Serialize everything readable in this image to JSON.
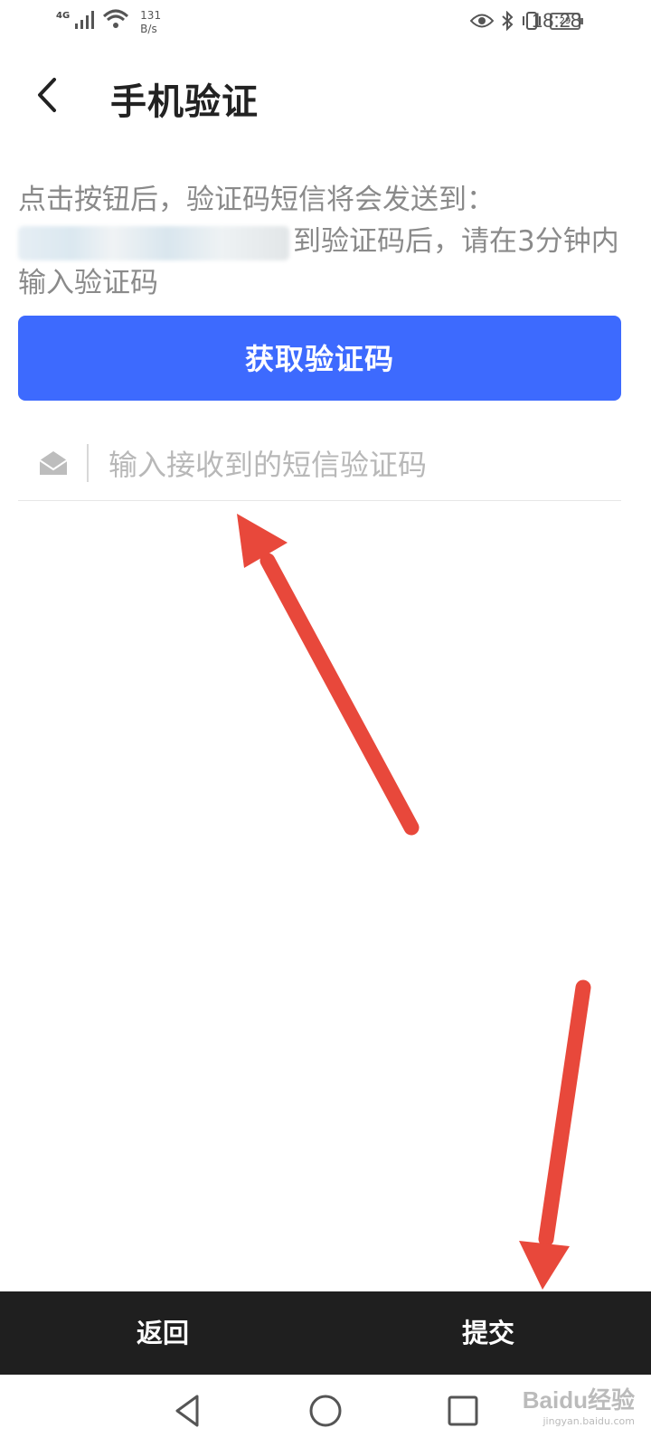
{
  "status_bar": {
    "network": "4G",
    "speed_value": "131",
    "speed_unit": "B/s",
    "battery": "29",
    "time": "18:28"
  },
  "header": {
    "title": "手机验证"
  },
  "description": {
    "line1": "点击按钮后，验证码短信将会发送到：",
    "line2_visible": "到验证码后，请在3分钟内",
    "line3": "输入验证码"
  },
  "get_code_button": {
    "label": "获取验证码"
  },
  "code_input": {
    "value": "",
    "placeholder": "输入接收到的短信验证码"
  },
  "action_bar": {
    "back_label": "返回",
    "submit_label": "提交"
  },
  "watermark": {
    "main": "Baidu经验",
    "sub": "jingyan.baidu.com"
  },
  "colors": {
    "primary": "#3d6afe",
    "action_bar_bg": "#1f1f1f",
    "annotation_arrow": "#e8483b"
  }
}
